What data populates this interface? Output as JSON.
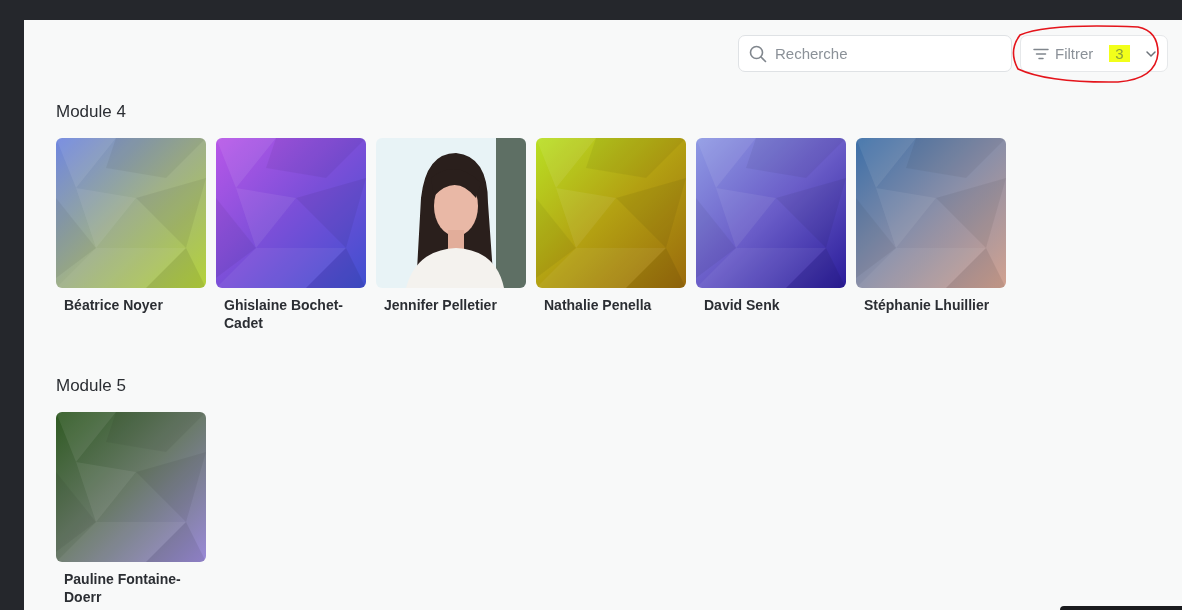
{
  "search": {
    "placeholder": "Recherche"
  },
  "filter": {
    "label": "Filtrer",
    "count": "3"
  },
  "modules": [
    {
      "title": "Module 4",
      "members": [
        {
          "name": "Béatrice Noyer",
          "kind": "pattern"
        },
        {
          "name": "Ghislaine Bochet-Cadet",
          "kind": "pattern"
        },
        {
          "name": "Jennifer Pelletier",
          "kind": "picture"
        },
        {
          "name": "Nathalie Penella",
          "kind": "pattern"
        },
        {
          "name": "David Senk",
          "kind": "pattern"
        },
        {
          "name": "Stéphanie Lhuillier",
          "kind": "pattern"
        }
      ]
    },
    {
      "title": "Module 5",
      "members": [
        {
          "name": "Pauline Fontaine-Doerr",
          "kind": "pattern"
        }
      ]
    }
  ]
}
